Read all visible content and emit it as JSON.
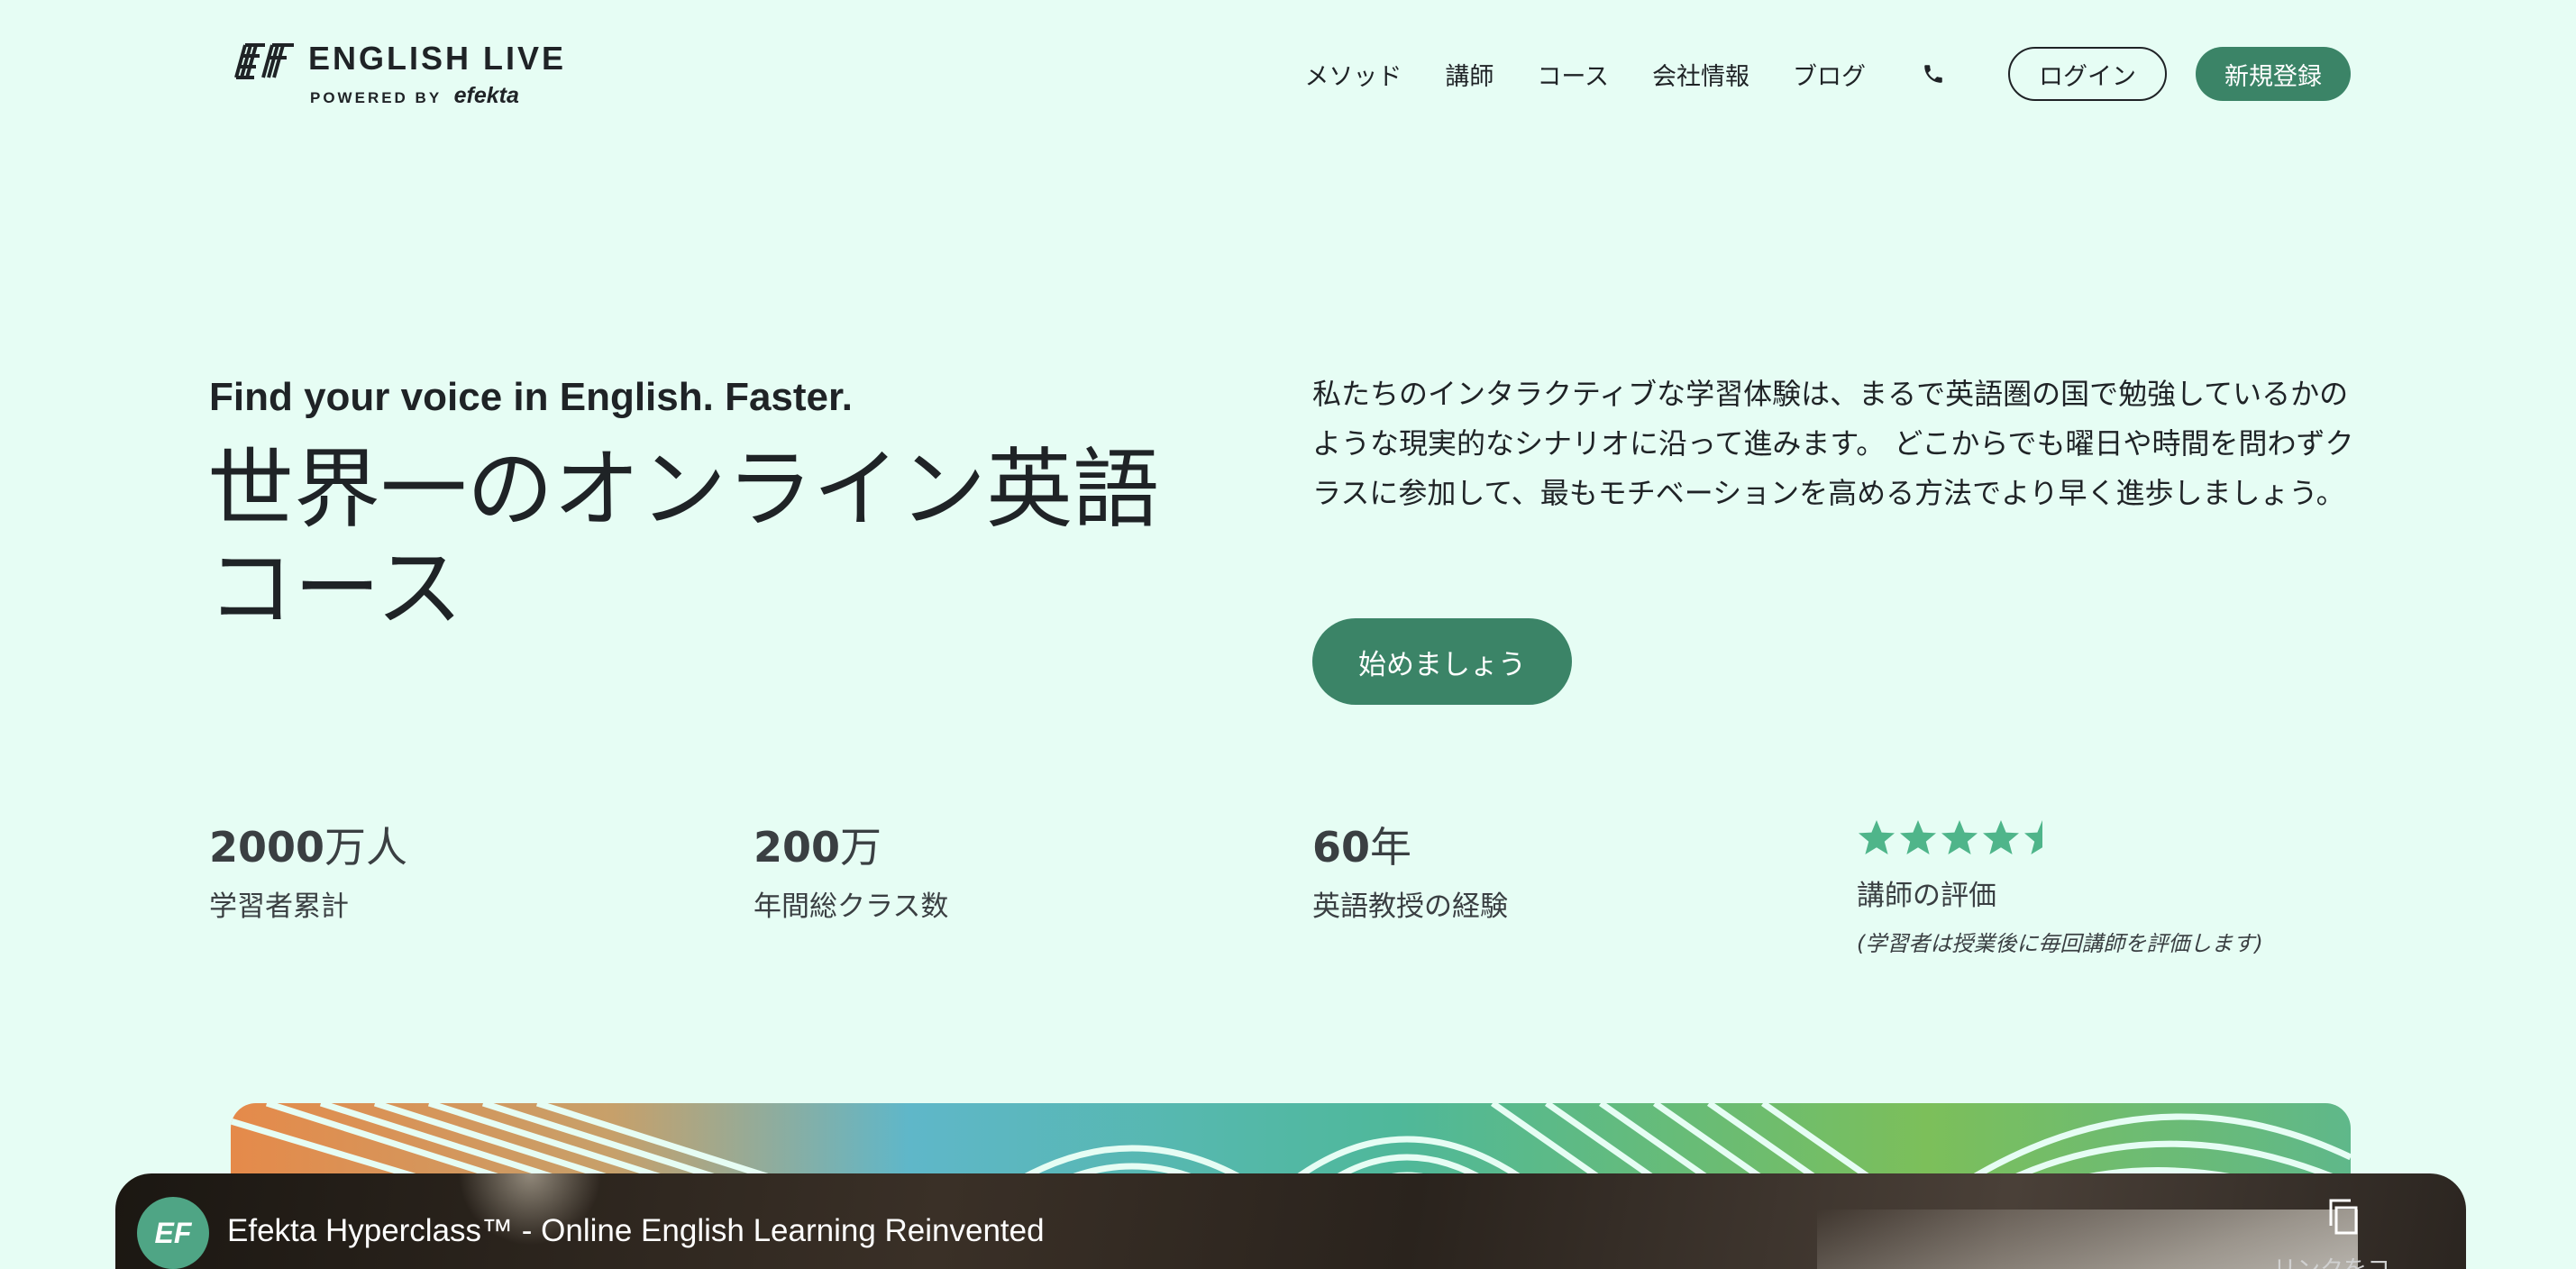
{
  "header": {
    "logo": {
      "mark": "EF",
      "title": "ENGLISH LIVE",
      "powered_by": "POWERED BY",
      "brand": "efekta"
    },
    "nav": [
      "メソッド",
      "講師",
      "コース",
      "会社情報",
      "ブログ"
    ],
    "phone_icon": "phone-icon",
    "login_label": "ログイン",
    "signup_label": "新規登録"
  },
  "hero": {
    "tagline": "Find your voice in English. Faster.",
    "headline_line1": "世界一のオンライン英語",
    "headline_line2": "コース",
    "description": "私たちのインタラクティブな学習体験は、まるで英語圏の国で勉強しているかのような現実的なシナリオに沿って進みます。 どこからでも曜日や時間を問わずクラスに参加して、最もモチベーションを高める方法でより早く進歩しましょう。",
    "cta_label": "始めましょう"
  },
  "stats": [
    {
      "number": "2000",
      "unit": "万人",
      "label": "学習者累計"
    },
    {
      "number": "200",
      "unit": "万",
      "label": "年間総クラス数"
    },
    {
      "number": "60",
      "unit": "年",
      "label": "英語教授の経験"
    }
  ],
  "rating": {
    "stars": 4.5,
    "max": 5,
    "label": "講師の評価",
    "note": "(学習者は授業後に毎回講師を評価します)"
  },
  "video": {
    "avatar": "EF",
    "title": "Efekta Hyperclass™ - Online English Learning Reinvented",
    "copy_label": "リンクをコ",
    "copy_icon": "copy-icon"
  },
  "colors": {
    "background": "#e6fdf4",
    "accent": "#3b8467",
    "star": "#4fb58a",
    "text": "#1f2326"
  }
}
